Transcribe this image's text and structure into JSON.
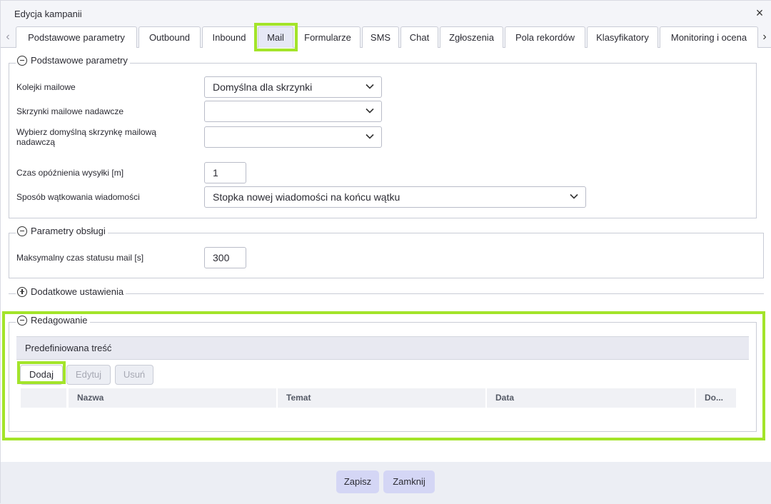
{
  "window": {
    "title": "Edycja kampanii",
    "close_icon": "×"
  },
  "tabs": [
    "Podstawowe parametry",
    "Outbound",
    "Inbound",
    "Mail",
    "Formularze",
    "SMS",
    "Chat",
    "Zgłoszenia",
    "Pola rekordów",
    "Klasyfikatory",
    "Monitoring i ocena"
  ],
  "active_tab": "Mail",
  "nav": {
    "prev_icon": "‹",
    "next_icon": "›"
  },
  "basic": {
    "legend": "Podstawowe parametry",
    "mail_queues": {
      "label": "Kolejki mailowe",
      "value": "Domyślna dla skrzynki"
    },
    "sender_mailboxes": {
      "label": "Skrzynki mailowe nadawcze",
      "value": ""
    },
    "default_sender": {
      "label": "Wybierz domyślną skrzynkę mailową nadawczą",
      "value": ""
    },
    "send_delay": {
      "label": "Czas opóźnienia wysyłki [m]",
      "value": "1"
    },
    "threading": {
      "label": "Sposób wątkowania wiadomości",
      "value": "Stopka nowej wiadomości na końcu wątku"
    }
  },
  "handling": {
    "legend": "Parametry obsługi",
    "max_status": {
      "label": "Maksymalny czas statusu mail [s]",
      "value": "300"
    }
  },
  "additional": {
    "legend": "Dodatkowe ustawienia"
  },
  "editing": {
    "legend": "Redagowanie",
    "grid_title": "Predefiniowana treść",
    "buttons": {
      "add": "Dodaj",
      "edit": "Edytuj",
      "remove": "Usuń"
    },
    "columns": [
      "Nazwa",
      "Temat",
      "Data",
      "Do..."
    ]
  },
  "footer": {
    "save": "Zapisz",
    "close": "Zamknij"
  },
  "colors": {
    "highlight": "#a3e42a",
    "primary_button": "#d4d6f5",
    "active_tab": "#e6e8f6"
  }
}
